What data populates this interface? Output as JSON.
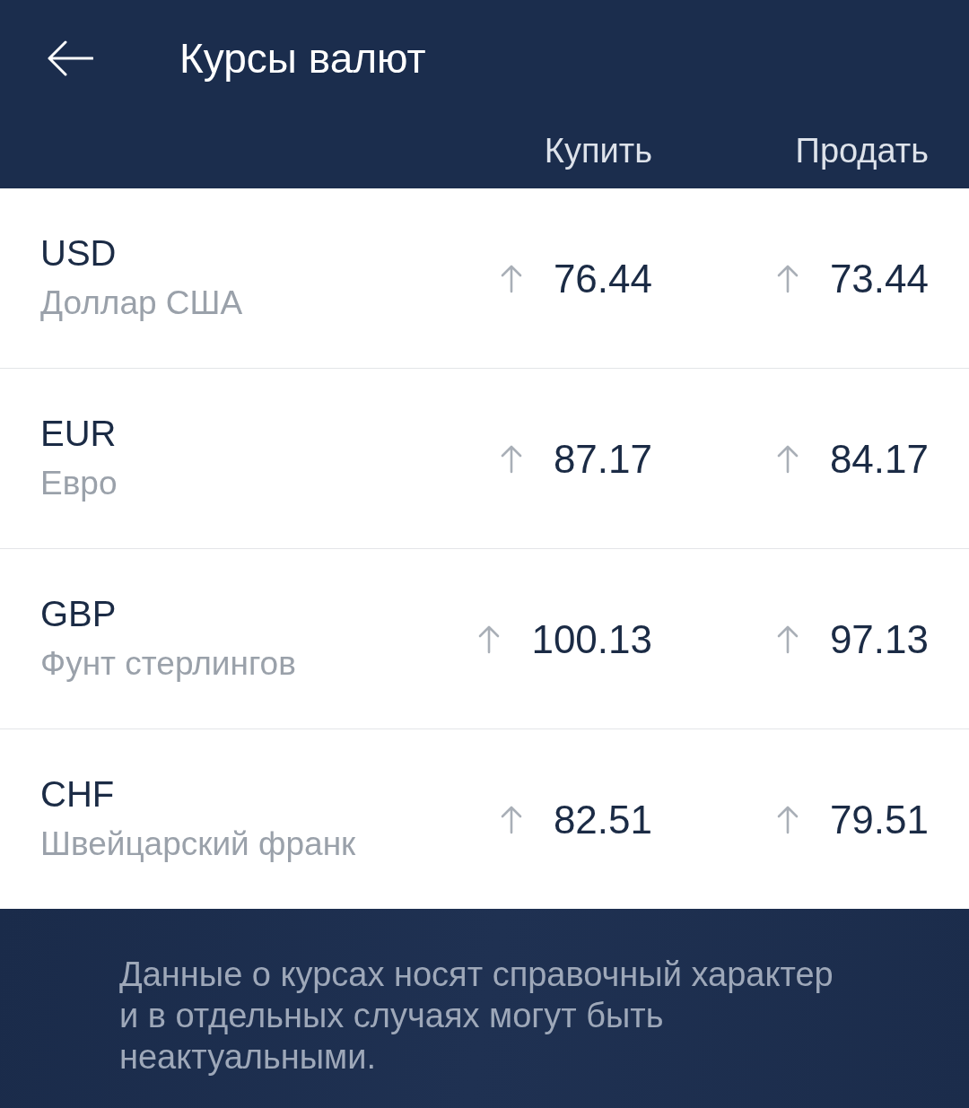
{
  "header": {
    "title": "Курсы валют",
    "columns": [
      "Купить",
      "Продать"
    ]
  },
  "rates": [
    {
      "code": "USD",
      "name": "Доллар США",
      "buy": {
        "value": "76.44",
        "rising": true
      },
      "sell": {
        "value": "73.44",
        "rising": true
      }
    },
    {
      "code": "EUR",
      "name": "Евро",
      "buy": {
        "value": "87.17",
        "rising": true
      },
      "sell": {
        "value": "84.17",
        "rising": true
      }
    },
    {
      "code": "GBP",
      "name": "Фунт стерлингов",
      "buy": {
        "value": "100.13",
        "rising": true
      },
      "sell": {
        "value": "97.13",
        "rising": true
      }
    },
    {
      "code": "CHF",
      "name": "Швейцарский франк",
      "buy": {
        "value": "82.51",
        "rising": true
      },
      "sell": {
        "value": "79.51",
        "rising": true
      }
    }
  ],
  "footer": {
    "note": "Данные о курсах носят справочный характер и в отдельных случаях могут быть неактуальными."
  }
}
